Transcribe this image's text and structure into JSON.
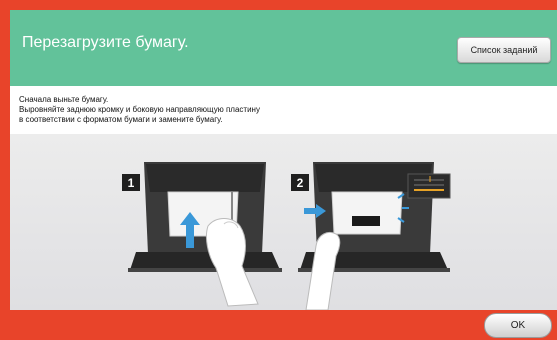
{
  "header": {
    "title": "Перезагрузите бумагу.",
    "job_list_button": "Список заданий"
  },
  "instructions": {
    "line1": "Сначала выньте бумагу.",
    "line2": "Выровняйте заднюю кромку и боковую направляющую пластину",
    "line3": "в соответствии с форматом бумаги и замените бумагу."
  },
  "steps": {
    "step1": "1",
    "step2": "2"
  },
  "footer": {
    "ok_button": "OK"
  },
  "colors": {
    "header_bg": "#62c29a",
    "frame": "#e8442a",
    "arrow": "#3a98d8"
  },
  "icons": [
    "up-arrow-icon",
    "right-arrow-icon"
  ]
}
